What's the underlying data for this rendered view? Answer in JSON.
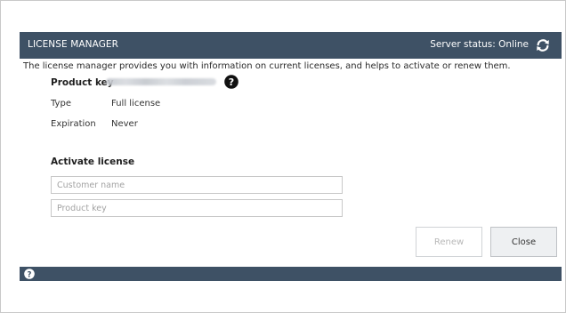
{
  "header": {
    "title": "LICENSE MANAGER",
    "server_status": "Server status: Online"
  },
  "intro": "The license manager provides you with information on current licenses, and helps to activate or renew them.",
  "license": {
    "product_key_label": "Product key",
    "type_label": "Type",
    "type_value": "Full license",
    "expiration_label": "Expiration",
    "expiration_value": "Never"
  },
  "activate": {
    "heading": "Activate license",
    "customer_name_placeholder": "Customer name",
    "product_key_placeholder": "Product key"
  },
  "buttons": {
    "renew": "Renew",
    "close": "Close"
  },
  "colors": {
    "header_bg": "#3e5165",
    "footer_bg": "#3e5165",
    "text": "#333333"
  },
  "icons": {
    "refresh": "refresh-icon",
    "help": "question-circle-icon"
  }
}
